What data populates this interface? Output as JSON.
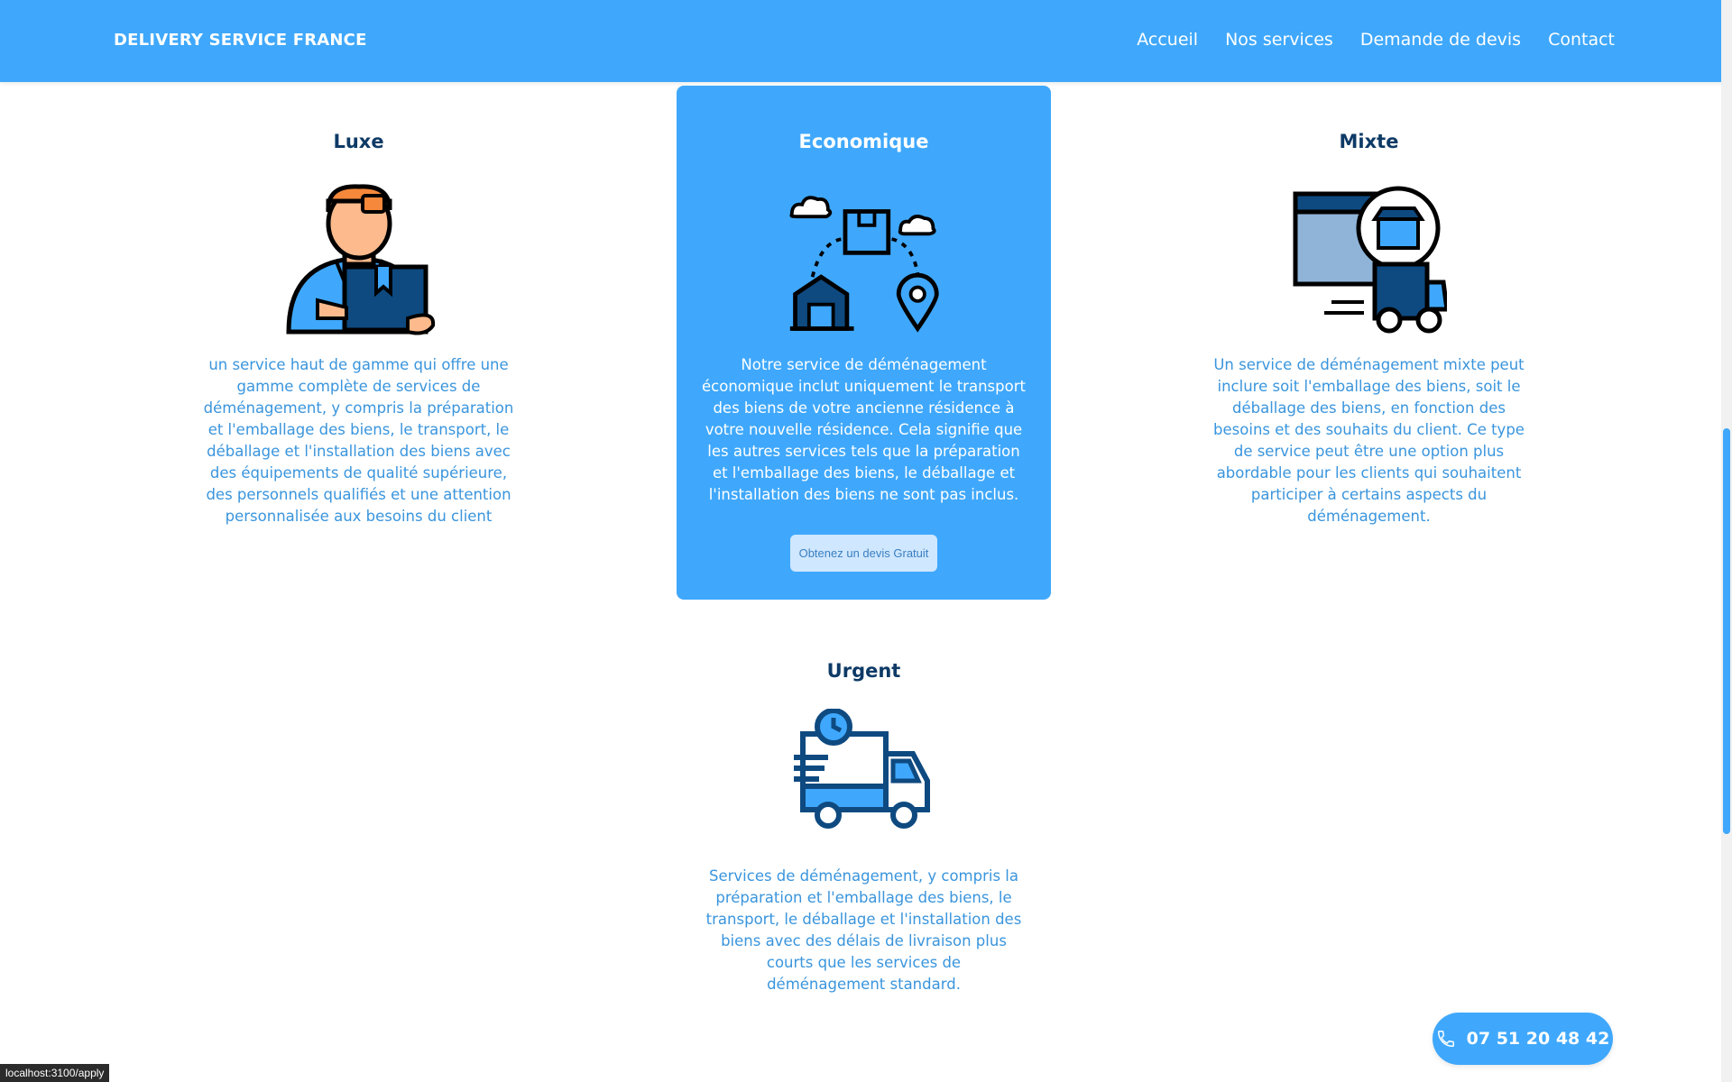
{
  "header": {
    "brand": "DELIVERY SERVICE FRANCE",
    "nav": [
      {
        "label": "Accueil"
      },
      {
        "label": "Nos services"
      },
      {
        "label": "Demande de devis"
      },
      {
        "label": "Contact"
      }
    ]
  },
  "services": [
    {
      "title": "Luxe",
      "icon": "delivery-man-icon",
      "text": "un service haut de gamme qui offre une gamme complète de services de déménagement, y compris la préparation et l'emballage des biens, le transport, le déballage et l'installation des biens avec des équipements de qualité supérieure, des personnels qualifiés et une attention personnalisée aux besoins du client"
    },
    {
      "title": "Economique",
      "icon": "parcel-route-icon",
      "text": "Notre service de déménagement économique inclut uniquement le transport des biens de votre ancienne résidence à votre nouvelle résidence. Cela signifie que les autres services tels que la préparation et l'emballage des biens, le déballage et l'installation des biens ne sont pas inclus.",
      "button": "Obtenez un devis Gratuit"
    },
    {
      "title": "Mixte",
      "icon": "online-store-delivery-icon",
      "text": "Un service de déménagement mixte peut inclure soit l'emballage des biens, soit le déballage des biens, en fonction des besoins et des souhaits du client. Ce type de service peut être une option plus abordable pour les clients qui souhaitent participer à certains aspects du déménagement."
    },
    {
      "title": "Urgent",
      "icon": "fast-delivery-truck-icon",
      "text": "Services de déménagement, y compris la préparation et l'emballage des biens, le transport, le déballage et l'installation des biens avec des délais de livraison plus courts que les services de déménagement standard."
    }
  ],
  "phone": {
    "icon": "phone-icon",
    "number": "07 51 20 48 42"
  },
  "status_bar": {
    "url": "localhost:3100/apply"
  },
  "colors": {
    "primary": "#3fa8fc",
    "title": "#0e3a66",
    "text": "#3a95dd",
    "button_bg": "#cfe7ff"
  }
}
